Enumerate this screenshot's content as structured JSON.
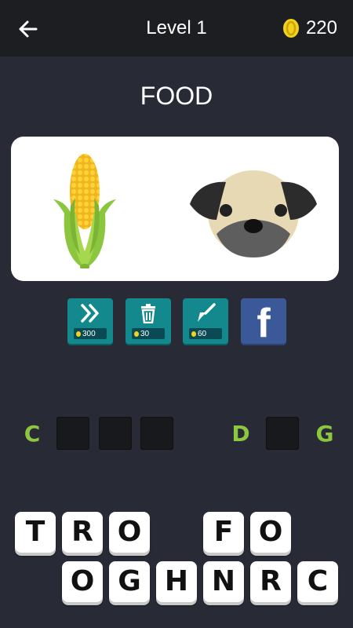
{
  "header": {
    "level": "Level 1",
    "coins": "220",
    "icons": {
      "back": "back-arrow-icon",
      "coin": "coin-icon"
    }
  },
  "category": "FOOD",
  "puzzle_images": [
    "corn",
    "pug-dog-face"
  ],
  "hints": [
    {
      "name": "skip-level",
      "icon": "double-chevron-icon",
      "cost": "300"
    },
    {
      "name": "remove-letters",
      "icon": "trash-icon",
      "cost": "30"
    },
    {
      "name": "reveal-letter",
      "icon": "brush-icon",
      "cost": "60"
    },
    {
      "name": "facebook-share",
      "icon": "facebook-icon",
      "label": "f"
    }
  ],
  "answer": {
    "word1": {
      "revealed": "C",
      "slots": 3
    },
    "word2": {
      "revealed": [
        "D",
        "G"
      ],
      "slots": 1
    },
    "colors": {
      "revealed": "#8dc63f",
      "slot": "#18191c"
    }
  },
  "letter_tiles": {
    "row1": [
      "T",
      "R",
      "O",
      "",
      "F",
      "O"
    ],
    "row2": [
      "O",
      "G",
      "H",
      "N",
      "R",
      "C"
    ]
  },
  "colors": {
    "background": "#282a36",
    "topbar": "#1d1e22",
    "hint": "#13898e",
    "facebook": "#3b5998"
  }
}
